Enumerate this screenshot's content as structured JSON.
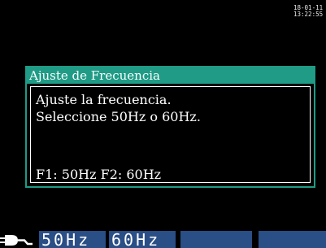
{
  "status": {
    "date": "18-01-11",
    "time": "13:22:55"
  },
  "dialog": {
    "title": "Ajuste de Frecuencia",
    "line1": "Ajuste la frecuencia.",
    "line2": "Seleccione 50Hz o 60Hz.",
    "line3": "F1: 50Hz  F2: 60Hz"
  },
  "softkeys": {
    "f1": "50Hz",
    "f2": "60Hz",
    "f3": "",
    "f4": ""
  },
  "colors": {
    "dialog_accent": "#1f9b86",
    "softkey_bg": "#2a4e86",
    "background": "#000000"
  },
  "icons": {
    "power": "power-plug-icon"
  }
}
